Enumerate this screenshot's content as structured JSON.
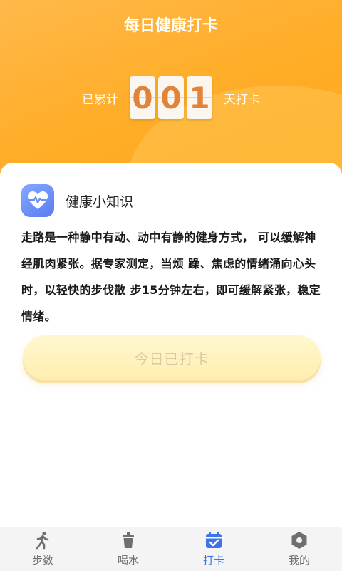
{
  "header": {
    "title": "每日健康打卡",
    "counter_prefix": "已累计",
    "digits": [
      "0",
      "0",
      "1"
    ],
    "counter_suffix": "天打卡"
  },
  "tip": {
    "icon": "heart-pulse-icon",
    "title": "健康小知识",
    "text": "走路是一种静中有动、动中有静的健身方式， 可以缓解神经肌肉紧张。据专家测定，当烦 躁、焦虑的情绪涌向心头时，以轻快的步伐散 步15分钟左右，即可缓解紧张，稳定情绪。"
  },
  "checkin": {
    "label": "今日已打卡"
  },
  "tabs": [
    {
      "label": "步数",
      "icon": "walk-icon",
      "active": false
    },
    {
      "label": "喝水",
      "icon": "cup-icon",
      "active": false
    },
    {
      "label": "打卡",
      "icon": "calendar-check-icon",
      "active": true
    },
    {
      "label": "我的",
      "icon": "profile-hex-icon",
      "active": false
    }
  ],
  "colors": {
    "header": "#ffae2a",
    "digit_text": "#e1843a",
    "tab_active": "#3d74ea",
    "tab_inactive": "#6f6f6f"
  }
}
